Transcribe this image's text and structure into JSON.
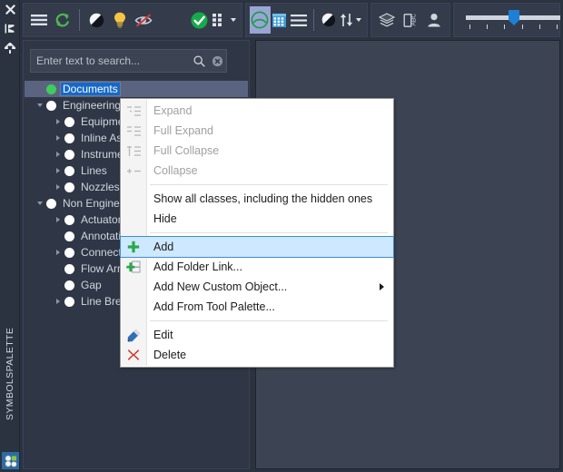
{
  "sidebar": {
    "icons": [
      {
        "name": "close-icon",
        "glyph": "close"
      },
      {
        "name": "auto-hide-pin-icon",
        "glyph": "pin"
      },
      {
        "name": "settings-gear-icon",
        "glyph": "gear"
      }
    ],
    "vertical_label": "SYMBOLSPALETTE",
    "bottom_button_name": "symbol-palette-button"
  },
  "toolbar": {
    "group1": [
      {
        "name": "menu-hamburger-button",
        "icon": "hamburger-icon",
        "label": "Menu"
      },
      {
        "name": "refresh-button",
        "icon": "refresh-icon",
        "label": "Refresh"
      },
      {
        "name": "separator",
        "icon": "separator",
        "label": ""
      },
      {
        "name": "contrast-button",
        "icon": "half-circle-icon",
        "label": "Contrast"
      },
      {
        "name": "highlight-button",
        "icon": "lightbulb-icon",
        "label": "Highlight"
      },
      {
        "name": "hide-hidden-button",
        "icon": "eye-off-icon",
        "label": "Hide Hidden"
      },
      {
        "name": "spacer",
        "icon": "spacer",
        "label": ""
      },
      {
        "name": "validate-button",
        "icon": "check-circle-icon",
        "label": "Validate"
      },
      {
        "name": "grid-options-button",
        "icon": "dots-grid-icon",
        "label": "Options"
      },
      {
        "name": "grid-options-caret",
        "icon": "caret-down-icon",
        "label": ""
      }
    ],
    "group2": [
      {
        "name": "palette-tree-button",
        "icon": "circle-outline-icon",
        "label": "Tree View",
        "selected": true
      },
      {
        "name": "palette-grid-button",
        "icon": "table-grid-icon",
        "label": "Grid View",
        "selected": false
      },
      {
        "name": "palette-list-button",
        "icon": "list-icon",
        "label": "List View",
        "selected": false
      },
      {
        "name": "separator",
        "icon": "separator",
        "label": ""
      },
      {
        "name": "theme-button",
        "icon": "half-circle-icon",
        "label": "Theme"
      },
      {
        "name": "sort-button",
        "icon": "sort-arrows-icon",
        "label": "Sort"
      },
      {
        "name": "sort-caret",
        "icon": "caret-down-icon",
        "label": ""
      }
    ],
    "group3": [
      {
        "name": "layers-button",
        "icon": "layers-icon",
        "label": "Layers"
      },
      {
        "name": "label-abc-button",
        "icon": "abc-label-icon",
        "label": "Labels"
      },
      {
        "name": "user-button",
        "icon": "person-icon",
        "label": "User"
      }
    ],
    "slider": {
      "name": "zoom-slider",
      "value": 50,
      "min": 0,
      "max": 100,
      "tick_count": 6
    }
  },
  "search": {
    "value": "",
    "placeholder": "Enter text to search...",
    "search_icon": "magnifier-icon",
    "clear_icon": "clear-circle-icon"
  },
  "tree": {
    "items": [
      {
        "label": "Documents",
        "indent": 0,
        "twisty": "none",
        "dot": "green",
        "selected": true
      },
      {
        "label": "Engineering",
        "indent": 0,
        "twisty": "expanded",
        "dot": "white",
        "selected": false
      },
      {
        "label": "Equipment",
        "indent": 1,
        "twisty": "collapsed",
        "dot": "white",
        "selected": false
      },
      {
        "label": "Inline Assets",
        "indent": 1,
        "twisty": "collapsed",
        "dot": "white",
        "selected": false
      },
      {
        "label": "Instruments",
        "indent": 1,
        "twisty": "collapsed",
        "dot": "white",
        "selected": false
      },
      {
        "label": "Lines",
        "indent": 1,
        "twisty": "collapsed",
        "dot": "white",
        "selected": false
      },
      {
        "label": "Nozzles",
        "indent": 1,
        "twisty": "collapsed",
        "dot": "white",
        "selected": false
      },
      {
        "label": "Non Engineering",
        "indent": 0,
        "twisty": "expanded",
        "dot": "white",
        "selected": false
      },
      {
        "label": "Actuators",
        "indent": 1,
        "twisty": "collapsed",
        "dot": "white",
        "selected": false
      },
      {
        "label": "Annotation",
        "indent": 1,
        "twisty": "none",
        "dot": "white",
        "selected": false
      },
      {
        "label": "Connectors",
        "indent": 1,
        "twisty": "collapsed",
        "dot": "white",
        "selected": false
      },
      {
        "label": "Flow Arrows",
        "indent": 1,
        "twisty": "none",
        "dot": "white",
        "selected": false
      },
      {
        "label": "Gap",
        "indent": 1,
        "twisty": "none",
        "dot": "white",
        "selected": false
      },
      {
        "label": "Line Breaks",
        "indent": 1,
        "twisty": "collapsed",
        "dot": "white",
        "selected": false
      }
    ]
  },
  "context_menu": {
    "items": [
      {
        "label": "Expand",
        "icon": "expand-icon",
        "disabled": true,
        "highlight": false,
        "submenu": false
      },
      {
        "label": "Full Expand",
        "icon": "full-expand-icon",
        "disabled": true,
        "highlight": false,
        "submenu": false
      },
      {
        "label": "Full Collapse",
        "icon": "full-collapse-icon",
        "disabled": true,
        "highlight": false,
        "submenu": false
      },
      {
        "label": "Collapse",
        "icon": "collapse-icon",
        "disabled": true,
        "highlight": false,
        "submenu": false
      },
      {
        "separator": true
      },
      {
        "label": "Show all classes, including the hidden ones",
        "icon": "none",
        "disabled": false,
        "highlight": false,
        "submenu": false
      },
      {
        "label": "Hide",
        "icon": "none",
        "disabled": false,
        "highlight": false,
        "submenu": false
      },
      {
        "separator": true
      },
      {
        "label": "Add",
        "icon": "plus-icon",
        "disabled": false,
        "highlight": true,
        "submenu": false
      },
      {
        "label": "Add Folder Link...",
        "icon": "add-folder-icon",
        "disabled": false,
        "highlight": false,
        "submenu": false
      },
      {
        "label": "Add New Custom Object...",
        "icon": "none",
        "disabled": false,
        "highlight": false,
        "submenu": true
      },
      {
        "label": "Add From Tool Palette...",
        "icon": "none",
        "disabled": false,
        "highlight": false,
        "submenu": false
      },
      {
        "separator": true
      },
      {
        "label": "Edit",
        "icon": "pencil-icon",
        "disabled": false,
        "highlight": false,
        "submenu": false
      },
      {
        "label": "Delete",
        "icon": "red-x-icon",
        "disabled": false,
        "highlight": false,
        "submenu": false
      }
    ]
  },
  "colors": {
    "window_bg": "#2b3240",
    "panel_bg": "#2f3746",
    "right_pane_bg": "#3c4453",
    "toolbar_bg": "#343c4c",
    "accent_blue": "#1669c9",
    "selection_lavender": "#9aa5d4",
    "menu_highlight": "#cde8ff",
    "green_dot": "#3fcb5e",
    "text": "#cfd5df"
  }
}
